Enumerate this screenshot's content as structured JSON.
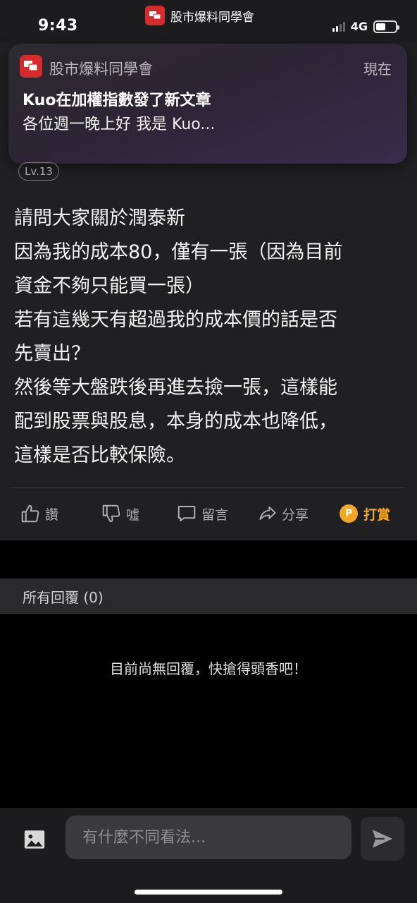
{
  "status_bar": {
    "time": "9:43",
    "app_name": "股市爆料同學會",
    "network": "4G",
    "battery_level": 0.5
  },
  "notification": {
    "app_name": "股市爆料同學會",
    "time": "現在",
    "title": "Kuo在加權指數發了新文章",
    "body": "各位週一晚上好 我是 Kuo..."
  },
  "author": {
    "level": "Lv.13"
  },
  "post": {
    "lines": [
      "請問大家關於潤泰新",
      "因為我的成本80，僅有一張（因為目前",
      "資金不夠只能買一張）",
      "若有這幾天有超過我的成本價的話是否",
      "先賣出？",
      "然後等大盤跌後再進去撿一張，這樣能",
      "配到股票與股息，本身的成本也降低，",
      "這樣是否比較保險。"
    ]
  },
  "actions": {
    "like": "讚",
    "boo": "噓",
    "comment": "留言",
    "share": "分享",
    "tip": "打賞",
    "tip_coin": "P"
  },
  "replies": {
    "header": "所有回覆 (0)",
    "empty_message": "目前尚無回覆，快搶得頭香吧！"
  },
  "composer": {
    "placeholder": "有什麼不同看法..."
  },
  "colors": {
    "accent_tip": "#f5a623",
    "brand": "#d52b2b"
  }
}
